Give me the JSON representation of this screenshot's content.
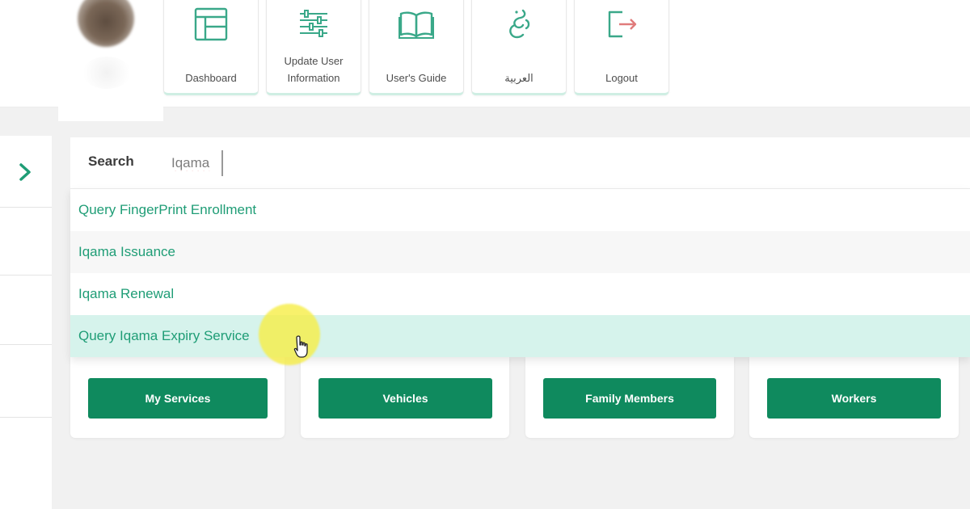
{
  "header": {
    "tiles": [
      {
        "label": "Dashboard",
        "icon": "dashboard-icon"
      },
      {
        "label": "Update User Information",
        "icon": "settings-sliders-icon"
      },
      {
        "label": "User's Guide",
        "icon": "book-icon"
      },
      {
        "label": "العربية",
        "icon": "arabic-language-icon"
      },
      {
        "label": "Logout",
        "icon": "logout-icon"
      }
    ]
  },
  "sidebar": {
    "toggle_icon": "chevron-right-icon"
  },
  "search": {
    "label": "Search",
    "value": "Iqama"
  },
  "dropdown": {
    "items": [
      {
        "label": "Query FingerPrint Enrollment"
      },
      {
        "label": "Iqama Issuance"
      },
      {
        "label": "Iqama Renewal"
      },
      {
        "label": "Query Iqama Expiry Service"
      }
    ]
  },
  "services": {
    "buttons": [
      {
        "label": "My Services"
      },
      {
        "label": "Vehicles"
      },
      {
        "label": "Family Members"
      },
      {
        "label": "Workers"
      }
    ]
  },
  "colors": {
    "accent": "#1f9d76",
    "button": "#0f8a5e",
    "highlight_row": "#d6f3ec",
    "icon": "#3aa889"
  }
}
